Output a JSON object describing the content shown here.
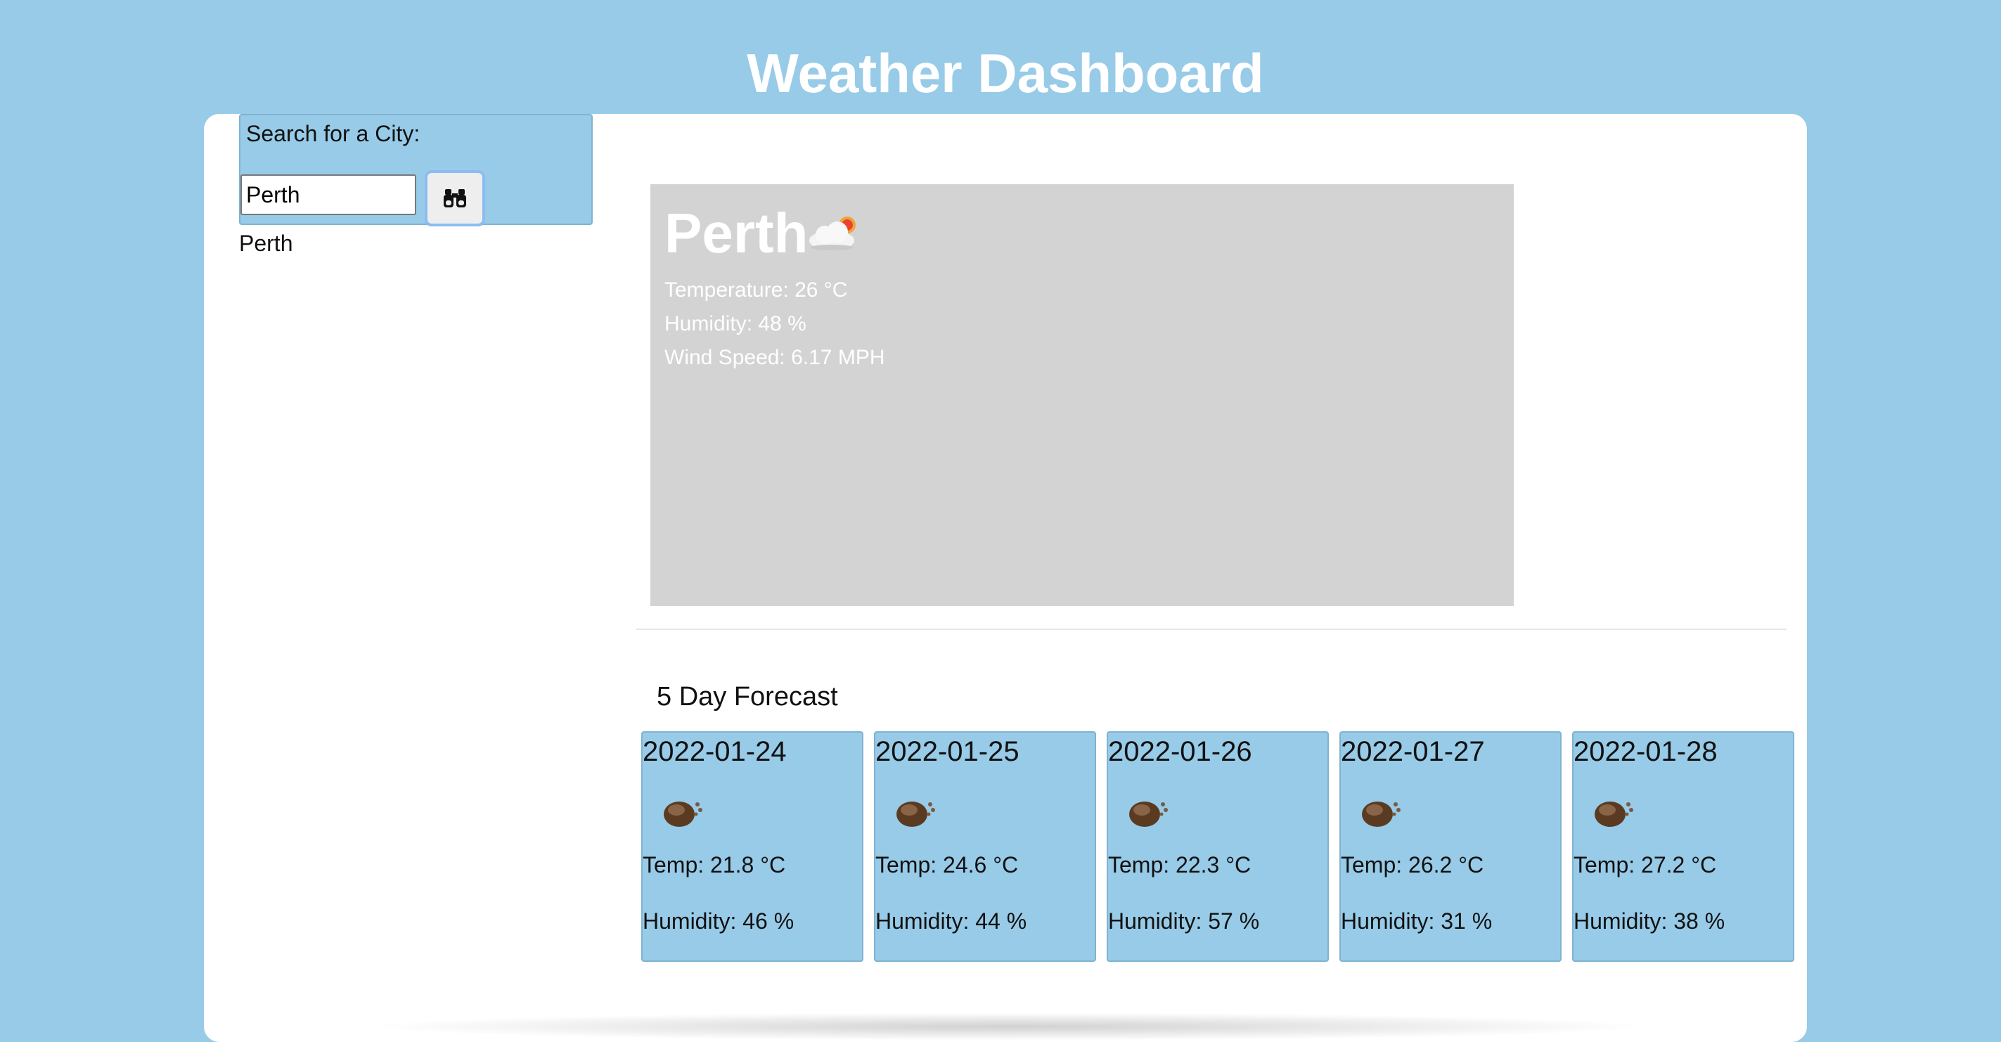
{
  "header": {
    "title": "Weather Dashboard"
  },
  "search": {
    "label": "Search for a City:",
    "input_value": "Perth",
    "button_icon": "binoculars-icon"
  },
  "history": [
    "Perth"
  ],
  "current": {
    "city": "Perth",
    "icon": "partly-cloudy-icon",
    "temperature": "Temperature: 26 °C",
    "humidity": "Humidity: 48 %",
    "wind": "Wind Speed: 6.17 MPH"
  },
  "forecast": {
    "title": "5 Day Forecast",
    "days": [
      {
        "date": "2022-01-24",
        "icon": "weather-icon",
        "temp": "Temp: 21.8 °C",
        "humidity": "Humidity: 46 %"
      },
      {
        "date": "2022-01-25",
        "icon": "weather-icon",
        "temp": "Temp: 24.6 °C",
        "humidity": "Humidity: 44 %"
      },
      {
        "date": "2022-01-26",
        "icon": "weather-icon",
        "temp": "Temp: 22.3 °C",
        "humidity": "Humidity: 57 %"
      },
      {
        "date": "2022-01-27",
        "icon": "weather-icon",
        "temp": "Temp: 26.2 °C",
        "humidity": "Humidity: 31 %"
      },
      {
        "date": "2022-01-28",
        "icon": "weather-icon",
        "temp": "Temp: 27.2 °C",
        "humidity": "Humidity: 38 %"
      }
    ]
  },
  "colors": {
    "page_background": "#97cbe8",
    "card_background": "#ffffff",
    "current_panel": "#d3d3d3"
  }
}
